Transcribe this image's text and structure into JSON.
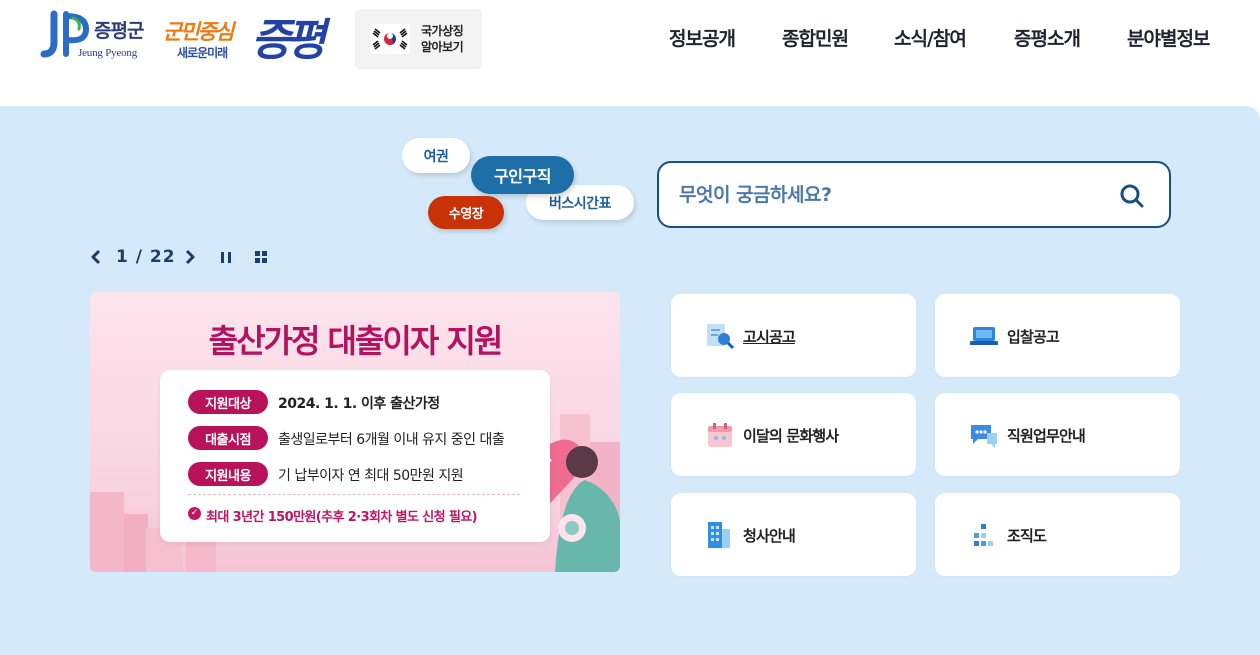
{
  "header": {
    "logo": {
      "name": "증평군",
      "english": "Jeung Pyeong"
    },
    "slogan": {
      "line1": "군민중심",
      "line2": "새로운미래",
      "big": "증평"
    },
    "national_symbols_button": {
      "line1": "국가상징",
      "line2": "알아보기"
    },
    "nav": [
      "정보공개",
      "종합민원",
      "소식/참여",
      "증평소개",
      "분야별정보"
    ]
  },
  "keywords": {
    "passport": "여권",
    "job": "구인구직",
    "bus": "버스시간표",
    "pool": "수영장"
  },
  "search": {
    "placeholder": "무엇이 궁금하세요?"
  },
  "slider": {
    "current": "1",
    "separator": "/",
    "total": "22"
  },
  "banner": {
    "title": "출산가정 대출이자 지원",
    "rows": [
      {
        "label": "지원대상",
        "text": "2024. 1. 1. 이후 출산가정"
      },
      {
        "label": "대출시점",
        "text": "출생일로부터 6개월 이내 유지 중인 대출"
      },
      {
        "label": "지원내용",
        "text": "기 납부이자 연 최대 50만원 지원"
      }
    ],
    "note": "최대 3년간 150만원(추후 2·3회차 별도 신청 필요)"
  },
  "quick_menu": [
    {
      "label": "고시공고",
      "icon": "document-search-icon"
    },
    {
      "label": "입찰공고",
      "icon": "laptop-icon"
    },
    {
      "label": "이달의 문화행사",
      "icon": "calendar-icon"
    },
    {
      "label": "직원업무안내",
      "icon": "chat-bubble-icon"
    },
    {
      "label": "청사안내",
      "icon": "building-icon"
    },
    {
      "label": "조직도",
      "icon": "org-chart-icon"
    }
  ],
  "colors": {
    "main_bg": "#d4e9fa",
    "accent_navy": "#1a4e86",
    "job_tag": "#1e6fa8",
    "pool_tag": "#c83206",
    "banner_accent": "#b8125a"
  }
}
